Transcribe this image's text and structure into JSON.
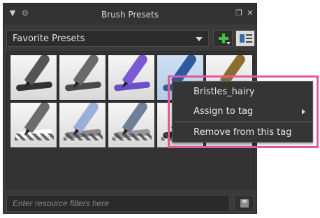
{
  "docker": {
    "title": "Brush Presets",
    "icons": [
      "collapse-triangle-icon",
      "lock-icon",
      "float-icon",
      "close-icon"
    ]
  },
  "preset_bar": {
    "selected_tag": "Favorite Presets",
    "add_button_icon": "plus-icon",
    "view_button_icon": "view-mode-icon"
  },
  "grid": {
    "presets": [
      {
        "icon": "ink-pen-icon",
        "stroke": "#333333",
        "tool": "#555555"
      },
      {
        "icon": "marker-icon",
        "stroke": "#4a4a4a",
        "tool": "#6a6a6a"
      },
      {
        "icon": "text-brush-icon",
        "stroke": "#6a4fc6",
        "tool": "#7b5ad6"
      },
      {
        "icon": "blue-pen-icon",
        "stroke": "#2e5f99",
        "tool": "#2b5aa0"
      },
      {
        "icon": "pencil-icon",
        "stroke": "#3a3a3a",
        "tool": "#8b6d2f"
      },
      {
        "icon": "eraser-shape-icon",
        "stroke": "#ffffff",
        "tool": "#6c6c6c"
      },
      {
        "icon": "eraser-icon",
        "stroke": "#8a8a8a",
        "tool": "#9ab0d8"
      },
      {
        "icon": "smudge-icon",
        "stroke": "#9a9a9a",
        "tool": "#6f7f98"
      },
      {
        "icon": "dark-brush-icon",
        "stroke": "#2a2a2a",
        "tool": "#3d3d3d"
      },
      {
        "icon": "bristles-icon",
        "stroke": "#1f1f1f",
        "tool": "#444444"
      }
    ]
  },
  "context_menu": {
    "items": [
      "Bristles_hairy",
      "Assign to tag",
      "Remove from this tag"
    ]
  },
  "filter": {
    "placeholder": "Enter resource filters here",
    "save_icon": "save-icon"
  },
  "colors": {
    "highlight": "#e05a9a",
    "panel_bg": "#3a3a3a",
    "add_green": "#3fc43f"
  }
}
